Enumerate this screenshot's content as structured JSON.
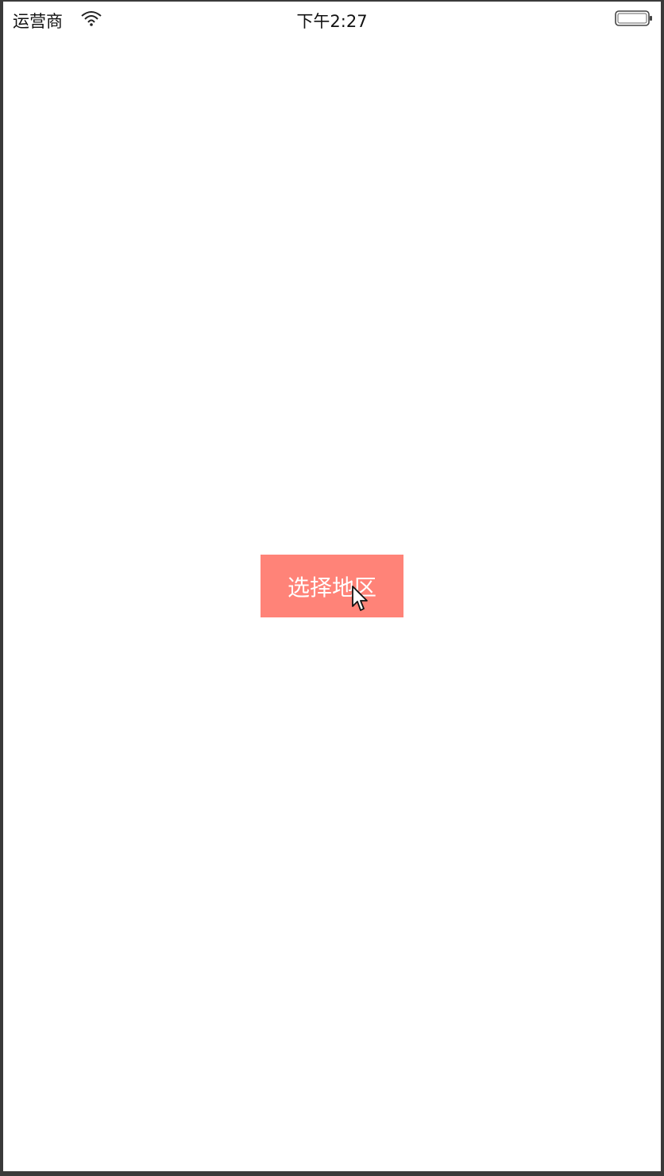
{
  "status_bar": {
    "carrier": "运营商",
    "time": "下午2:27"
  },
  "main": {
    "select_region_label": "选择地区"
  },
  "colors": {
    "button_bg": "#ff8378",
    "button_text": "#ffffff",
    "screen_bg": "#ffffff",
    "frame": "#3a3a3a"
  },
  "icons": {
    "wifi": "wifi-icon",
    "battery": "battery-icon",
    "cursor": "mouse-pointer-icon"
  }
}
